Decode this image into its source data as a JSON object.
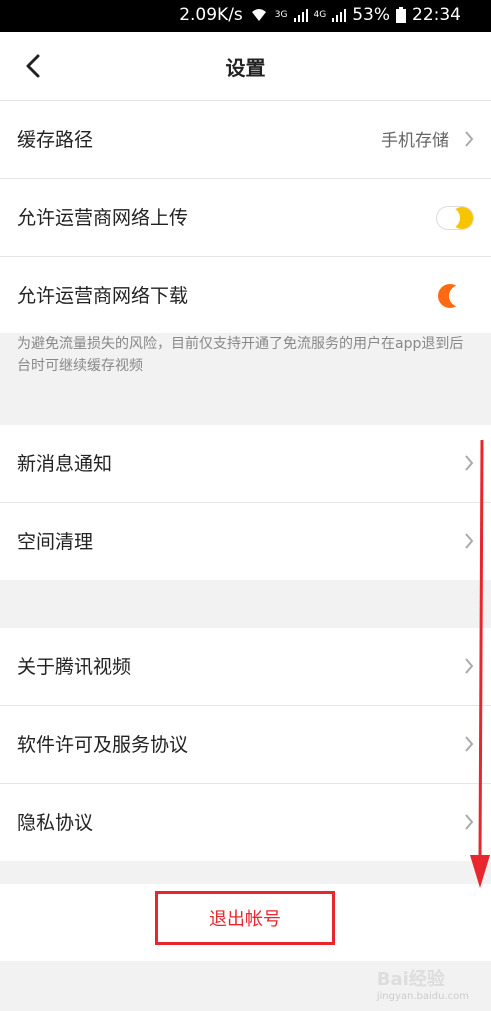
{
  "status_bar": {
    "speed": "2.09K/s",
    "net1": "3G",
    "net2": "4G",
    "battery": "53%",
    "time": "22:34"
  },
  "header": {
    "title": "设置"
  },
  "storage_section": {
    "cache_path_label": "缓存路径",
    "cache_path_value": "手机存储",
    "upload_label": "允许运营商网络上传",
    "upload_toggle": "off",
    "download_label": "允许运营商网络下载",
    "download_toggle": "on",
    "note": "为避免流量损失的风险，目前仅支持开通了免流服务的用户在app退到后台时可继续缓存视频"
  },
  "general_section": {
    "notifications_label": "新消息通知",
    "cleanup_label": "空间清理"
  },
  "about_section": {
    "about_label": "关于腾讯视频",
    "license_label": "软件许可及服务协议",
    "privacy_label": "隐私协议"
  },
  "logout": {
    "label": "退出帐号"
  },
  "colors": {
    "accent": "#ff6a13",
    "toggle_off": "#f7c400",
    "highlight": "#e8262e"
  },
  "watermark": {
    "text": "Bai经验",
    "sub": "jingyan.baidu.com"
  }
}
